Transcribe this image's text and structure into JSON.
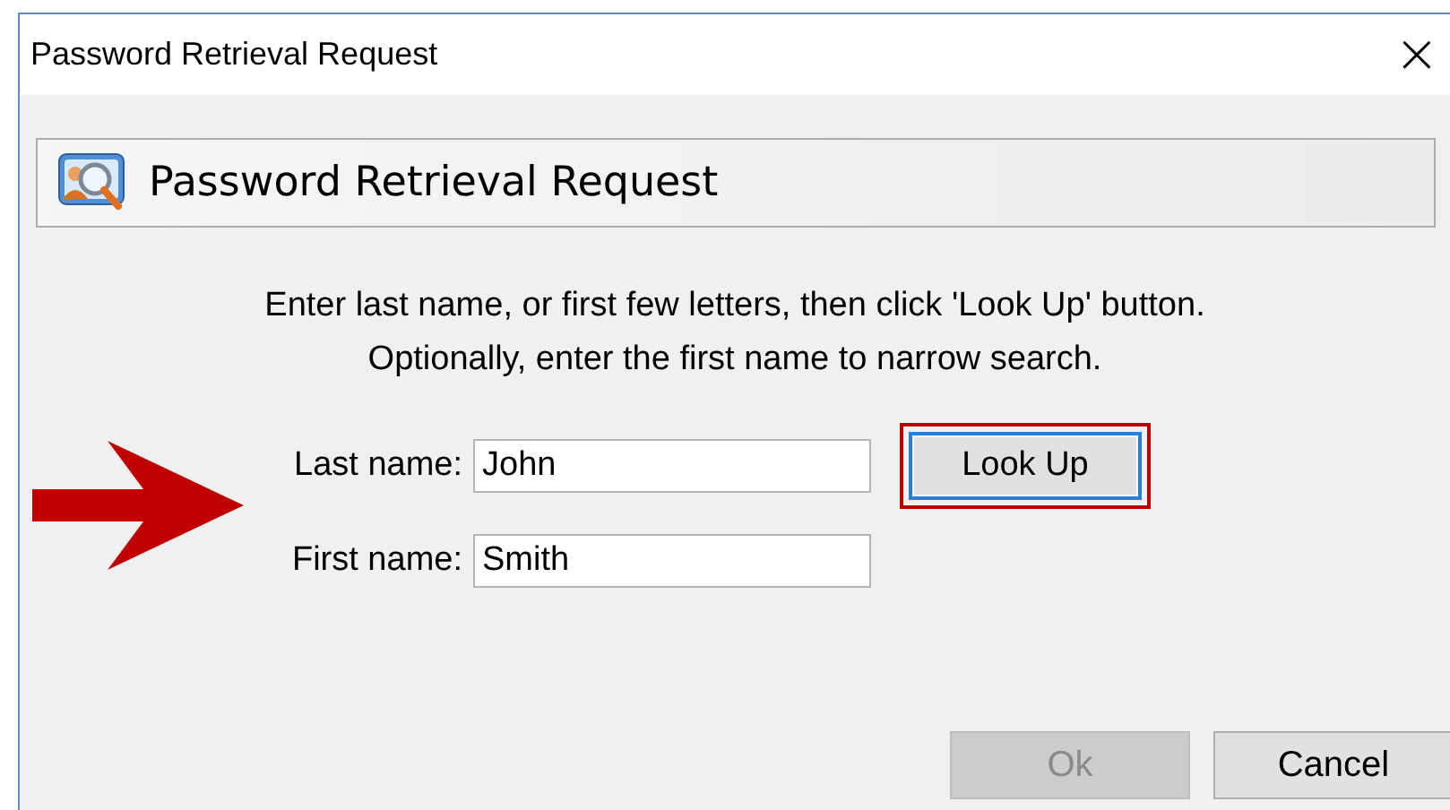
{
  "window": {
    "title": "Password Retrieval Request",
    "close": "×"
  },
  "header": {
    "title": "Password Retrieval Request"
  },
  "instructions": [
    "Enter last name, or first few letters, then click 'Look Up' button.",
    "Optionally, enter the first name to narrow search."
  ],
  "fields": [
    {
      "label": "Last name:",
      "value": "John"
    },
    {
      "label": "First name:",
      "value": "Smith"
    }
  ],
  "lookup_button": {
    "label": "Look Up",
    "highlighted": true
  },
  "buttons": [
    {
      "label": "Ok",
      "disabled": true
    },
    {
      "label": "Cancel",
      "disabled": false
    }
  ]
}
